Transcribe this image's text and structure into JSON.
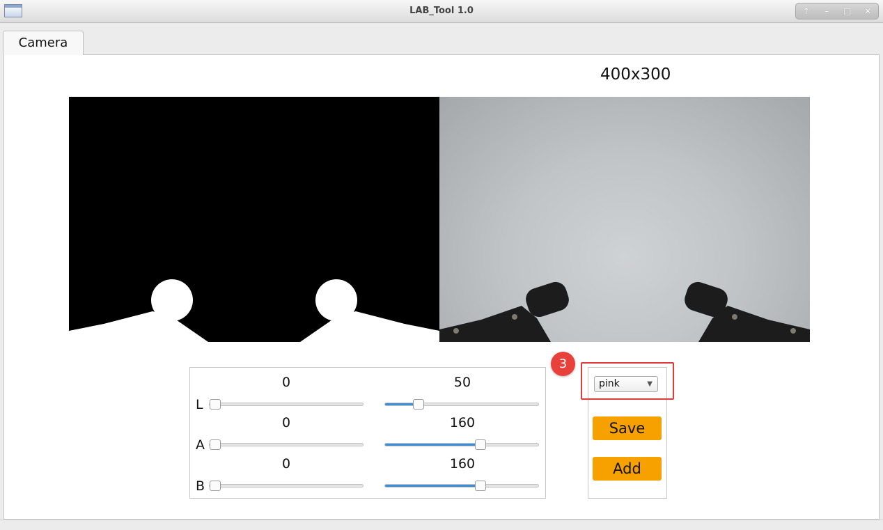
{
  "window": {
    "title": "LAB_Tool 1.0",
    "controls": [
      "↑",
      "–",
      "□",
      "✕"
    ]
  },
  "tabs": [
    {
      "label": "Camera"
    }
  ],
  "view": {
    "resolution": "400x300"
  },
  "sliders": {
    "range_max": 255,
    "rows": [
      {
        "channel": "L",
        "min": 0,
        "max": 50
      },
      {
        "channel": "A",
        "min": 0,
        "max": 160
      },
      {
        "channel": "B",
        "min": 0,
        "max": 160
      }
    ]
  },
  "color_select": {
    "value": "pink"
  },
  "buttons": {
    "save": "Save",
    "add": "Add"
  },
  "annotation": {
    "badge": "3"
  },
  "colors": {
    "accent_button": "#f7a100",
    "slider_fill": "#3d8ed6",
    "highlight": "#e03b3b"
  }
}
